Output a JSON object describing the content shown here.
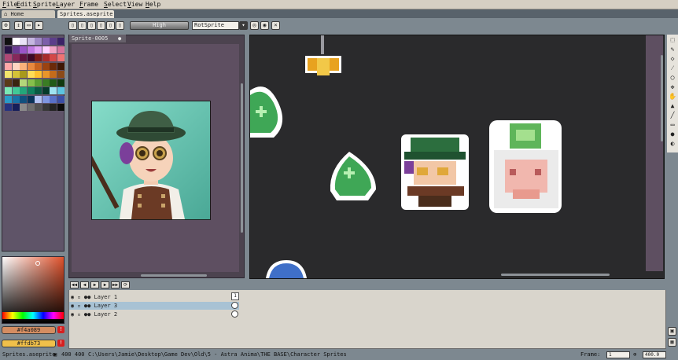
{
  "menu": [
    "File",
    "Edit",
    "Sprite",
    "Layer",
    "Frame",
    "Select",
    "View",
    "Help"
  ],
  "tabs": [
    {
      "label": "Home",
      "active": false
    },
    {
      "label": "Sprites.aseprite",
      "active": true
    }
  ],
  "toolbar": {
    "mode_label": "High",
    "layer_select_value": "RotSprite"
  },
  "preview": {
    "tab_label": "Sprite-0005"
  },
  "palette": {
    "colors": [
      "#101010",
      "#ffffff",
      "#e9e3f7",
      "#c5b7e0",
      "#9f89c6",
      "#7d5faa",
      "#5c3e8a",
      "#3b2366",
      "#2a1546",
      "#6b3c93",
      "#9a55c8",
      "#c17ae3",
      "#e2a4f5",
      "#ffd0ff",
      "#f2a3c4",
      "#d6739b",
      "#b04876",
      "#86285a",
      "#5e1440",
      "#3d0a2a",
      "#7a1c1c",
      "#a82c2c",
      "#d44848",
      "#f07474",
      "#ffa8a8",
      "#ffd5c2",
      "#f9b27a",
      "#e8893f",
      "#c8631f",
      "#9a4312",
      "#6b2a09",
      "#3e1804",
      "#f2e46b",
      "#d4c238",
      "#a8991c",
      "#ffdd57",
      "#ffc02e",
      "#e8952b",
      "#c46b1b",
      "#8c4b18",
      "#5a3a18",
      "#3a2410",
      "#b4d77a",
      "#86bf4c",
      "#5a9e33",
      "#3a7c24",
      "#215a17",
      "#113a10",
      "#7ae8b5",
      "#42c997",
      "#23a67a",
      "#11805e",
      "#0a5a43",
      "#063a2b",
      "#9ee2f0",
      "#5cc4e0",
      "#2a9bc8",
      "#1a72a6",
      "#10507e",
      "#0a3358",
      "#b3c3f2",
      "#7f96e0",
      "#5870c8",
      "#3a4ea6",
      "#263380",
      "#161e5a",
      "#8b8b8b",
      "#6e6e6e",
      "#525252",
      "#383838",
      "#242424",
      "#0c0c0c"
    ]
  },
  "colors": {
    "foreground_label": "#d48d61",
    "background_label": "#f0c04a",
    "foreground_hex": "#f4a089",
    "background_hex": "#ffdb73"
  },
  "timeline": {
    "layers": [
      {
        "name": "Layer 1",
        "selected": false
      },
      {
        "name": "Layer 3",
        "selected": true
      },
      {
        "name": "Layer 2",
        "selected": false
      }
    ],
    "frame_col": "1"
  },
  "status": {
    "file": "Sprites.aseprite",
    "size": "400 400",
    "path": "C:\\Users\\Jamie\\Desktop\\Game Dev\\Old\\5 - Astra Anima\\THE BASE\\Character Sprites",
    "frame_label": "Frame:",
    "frame_value": "1",
    "zoom_value": "400.0"
  }
}
